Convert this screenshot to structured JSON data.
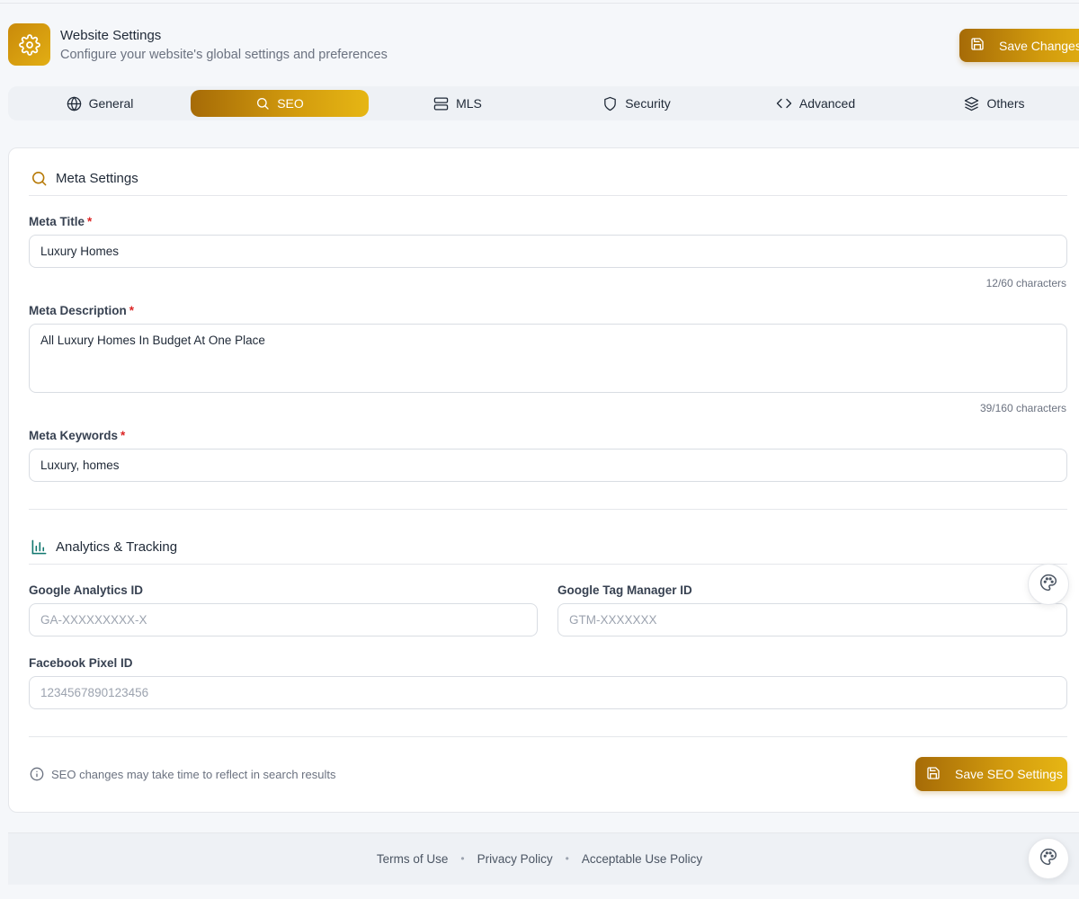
{
  "header": {
    "title": "Website Settings",
    "subtitle": "Configure your website's global settings and preferences",
    "save_label": "Save Changes"
  },
  "tabs": [
    {
      "label": "General",
      "icon": "globe-icon"
    },
    {
      "label": "SEO",
      "icon": "search-icon",
      "active": true
    },
    {
      "label": "MLS",
      "icon": "server-icon"
    },
    {
      "label": "Security",
      "icon": "shield-icon"
    },
    {
      "label": "Advanced",
      "icon": "code-icon"
    },
    {
      "label": "Others",
      "icon": "layers-icon"
    }
  ],
  "meta": {
    "section_title": "Meta Settings",
    "title_label": "Meta Title",
    "title_value": "Luxury Homes",
    "title_counter": "12/60 characters",
    "description_label": "Meta Description",
    "description_value": "All Luxury Homes In Budget At One Place",
    "description_counter": "39/160 characters",
    "keywords_label": "Meta Keywords",
    "keywords_value": "Luxury, homes",
    "required_mark": "*"
  },
  "analytics": {
    "section_title": "Analytics & Tracking",
    "ga_label": "Google Analytics ID",
    "ga_placeholder": "GA-XXXXXXXXX-X",
    "gtm_label": "Google Tag Manager ID",
    "gtm_placeholder": "GTM-XXXXXXX",
    "fb_label": "Facebook Pixel ID",
    "fb_placeholder": "1234567890123456"
  },
  "footer_note": "SEO changes may take time to reflect in search results",
  "save_seo_label": "Save SEO Settings",
  "footer": {
    "links": [
      "Terms of Use",
      "Privacy Policy",
      "Acceptable Use Policy"
    ],
    "separator": "•"
  },
  "colors": {
    "accent": "#d19a0d",
    "accent_dark": "#a66b07",
    "required": "#dc2626",
    "analytics_icon": "#0f766e"
  }
}
